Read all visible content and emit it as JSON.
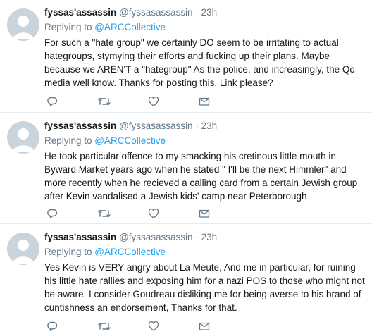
{
  "tweets": [
    {
      "name": "fyssas'assassin",
      "handle": "@fyssasassassin",
      "dot": "·",
      "time": "23h",
      "replying_prefix": "Replying to ",
      "replying_to": "@ARCCollective",
      "text": "For such a  \"hate group\" we certainly DO seem to be irritating to actual hategroups, stymying their efforts and fucking up their plans. Maybe because we AREN'T a \"hategroup\" As the police, and increasingly, the Qc media well know. Thanks for posting this. Link please?"
    },
    {
      "name": "fyssas'assassin",
      "handle": "@fyssasassassin",
      "dot": "·",
      "time": "23h",
      "replying_prefix": "Replying to ",
      "replying_to": "@ARCCollective",
      "text": "He took particular offence to my smacking his cretinous little mouth in Byward Market years ago when he stated \" I'll be the next Himmler\" and more recently when he recieved a calling card from a certain Jewish group after Kevin vandalised a Jewish kids' camp near Peterborough"
    },
    {
      "name": "fyssas'assassin",
      "handle": "@fyssasassassin",
      "dot": "·",
      "time": "23h",
      "replying_prefix": "Replying to ",
      "replying_to": "@ARCCollective",
      "text": "Yes Kevin is VERY angry about La Meute, And me in particular, for ruining his little hate rallies and exposing him for a nazi POS to those who might not be aware. I consider Goudreau disliking me for being averse to his brand of cuntishness an endorsement, Thanks for that."
    }
  ],
  "icons": [
    "reply-icon",
    "retweet-icon",
    "like-icon",
    "direct-message-icon",
    "default-avatar-icon"
  ],
  "colors": {
    "link": "#1da1f2",
    "muted": "#657786",
    "text": "#14171a",
    "divider": "#e6ecf0",
    "avatar_bg": "#c9d4dc",
    "avatar_fg": "#ffffff"
  }
}
